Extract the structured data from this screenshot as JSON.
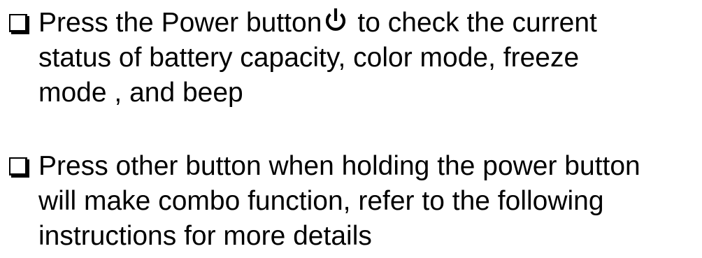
{
  "bullets": [
    {
      "lines": [
        {
          "before_icon": "Press the Power button",
          "after_icon": "to check the current"
        },
        {
          "text": "status of battery capacity, color mode, freeze"
        },
        {
          "text": "mode , and beep"
        }
      ],
      "icon": "power-icon"
    },
    {
      "lines": [
        {
          "text": "Press other button when holding the power button"
        },
        {
          "text": "will make combo function, refer to the following"
        },
        {
          "text": "instructions for more details"
        }
      ]
    }
  ],
  "icons": {
    "bullet": "checkbox-bullet-icon",
    "inline": "power-icon"
  },
  "colors": {
    "text": "#000000",
    "background": "#ffffff"
  }
}
